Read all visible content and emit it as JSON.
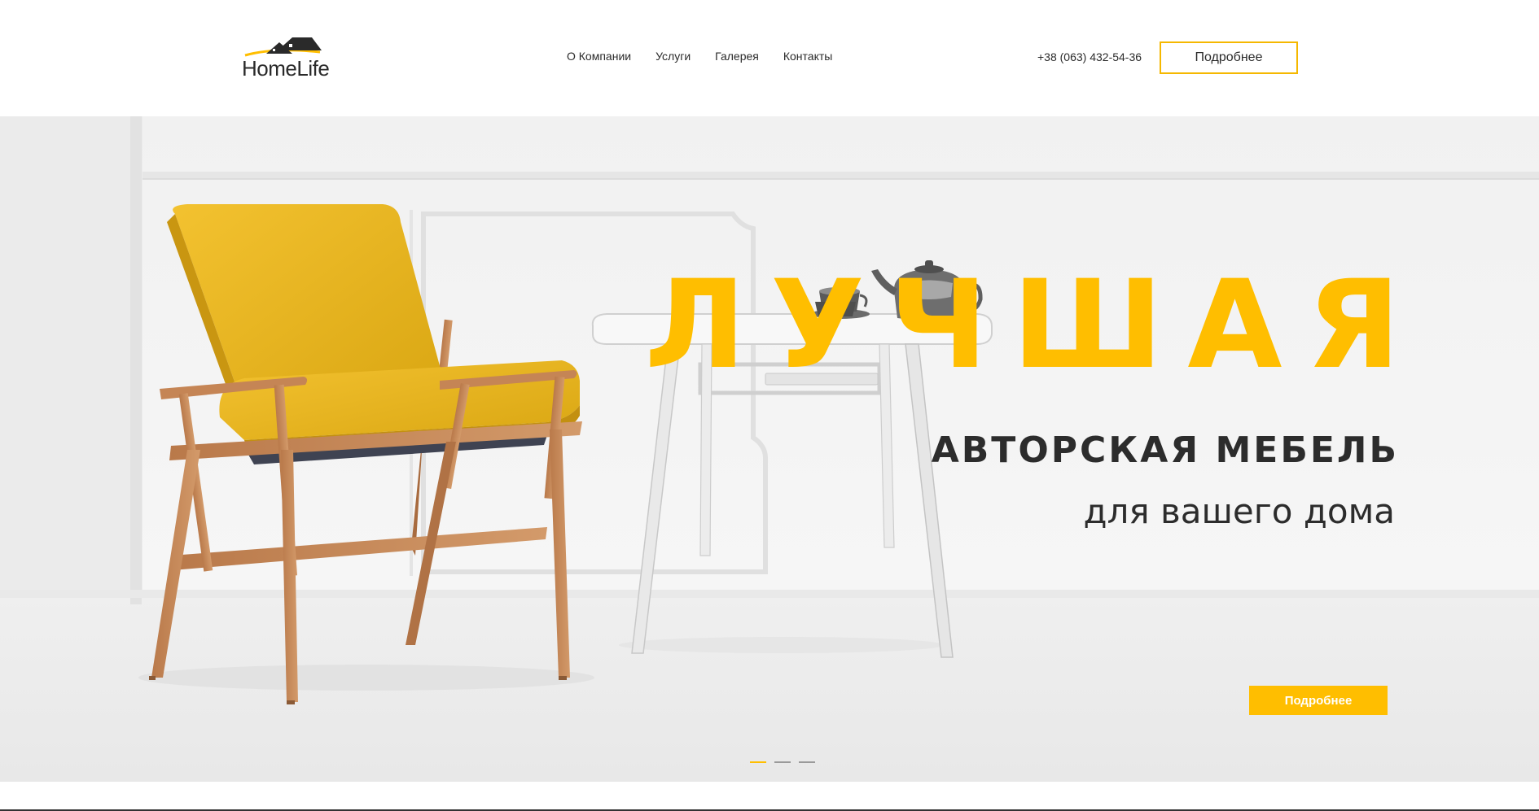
{
  "header": {
    "logo_text": "HomeLife",
    "nav": [
      {
        "label": "О Компании"
      },
      {
        "label": "Услуги"
      },
      {
        "label": "Галерея"
      },
      {
        "label": "Контакты"
      }
    ],
    "phone": "+38 (063) 432-54-36",
    "cta_label": "Подробнее"
  },
  "hero": {
    "title": "ЛУЧШАЯ",
    "subtitle": "АВТОРСКАЯ МЕБЕЛЬ",
    "tagline": "для вашего дома",
    "cta_label": "Подробнее",
    "slides_total": 3,
    "active_slide": 1
  },
  "colors": {
    "accent": "#ffbe00",
    "text": "#2b2b2b",
    "background": "#ffffff"
  }
}
